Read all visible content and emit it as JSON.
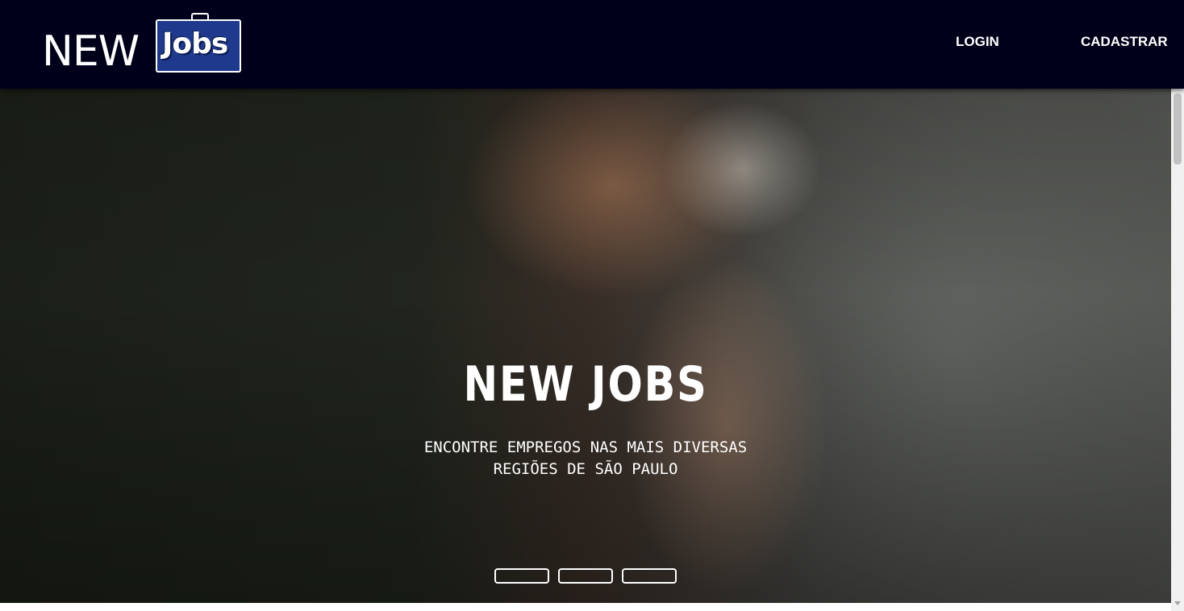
{
  "navbar": {
    "logo": {
      "word_new": "NEW",
      "word_jobs": "Jobs"
    },
    "links": {
      "login": "LOGIN",
      "cadastrar": "CADASTRAR"
    },
    "background_color": "#00001a"
  },
  "hero": {
    "title": "NEW JOBS",
    "subtitle": "ENCONTRE EMPREGOS NAS MAIS DIVERSAS\nREGIÕES DE SÃO PAULO",
    "carousel": {
      "slide_count": 3,
      "active_index": 0
    }
  },
  "colors": {
    "logo_box": "#1f3a8c",
    "text": "#ffffff"
  }
}
